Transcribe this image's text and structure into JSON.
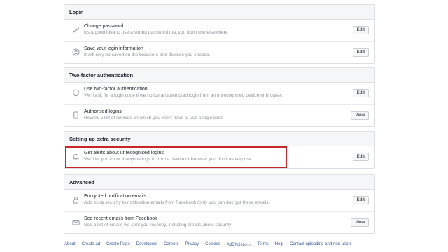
{
  "sections": [
    {
      "title": "Login",
      "rows": [
        {
          "icon": "key-icon",
          "title": "Change password",
          "desc": "It's a good idea to use a strong password that you don't use elsewhere",
          "button": "Edit"
        },
        {
          "icon": "user-circle-icon",
          "title": "Save your login information",
          "desc": "It will only be saved on the browsers and devices you choose.",
          "button": "Edit"
        }
      ]
    },
    {
      "title": "Two-factor authentication",
      "rows": [
        {
          "icon": "shield-icon",
          "title": "Use two-factor authentication",
          "desc": "We'll ask for a login code if we notice an attempted login from an unrecognised device or browser.",
          "button": "Edit"
        },
        {
          "icon": "phone-icon",
          "title": "Authorised logins",
          "desc": "Review a list of devices on which you won't have to use a login code",
          "button": "View"
        }
      ]
    },
    {
      "title": "Setting up extra security",
      "rows": [
        {
          "icon": "bell-icon",
          "title": "Get alerts about unrecognised logins",
          "desc": "We'll let you know if anyone logs in from a device or browser you don't usually use",
          "button": "Edit"
        }
      ]
    },
    {
      "title": "Advanced",
      "rows": [
        {
          "icon": "lock-icon",
          "title": "Encrypted notification emails",
          "desc": "Add extra security to notification emails from Facebook (only you can decrypt these emails)",
          "button": "Edit"
        },
        {
          "icon": "envelope-icon",
          "title": "See recent emails from Facebook",
          "desc": "See a list of emails we sent you recently, including emails about security",
          "button": "View"
        }
      ]
    }
  ],
  "footer": {
    "links": [
      "About",
      "Create ad",
      "Create Page",
      "Developers",
      "Careers",
      "Privacy",
      "Cookies",
      "AdChoices",
      "Terms",
      "Help",
      "Contact uploading and non-users"
    ]
  },
  "colors": {
    "highlight": "#c8262b",
    "link": "#385898"
  }
}
